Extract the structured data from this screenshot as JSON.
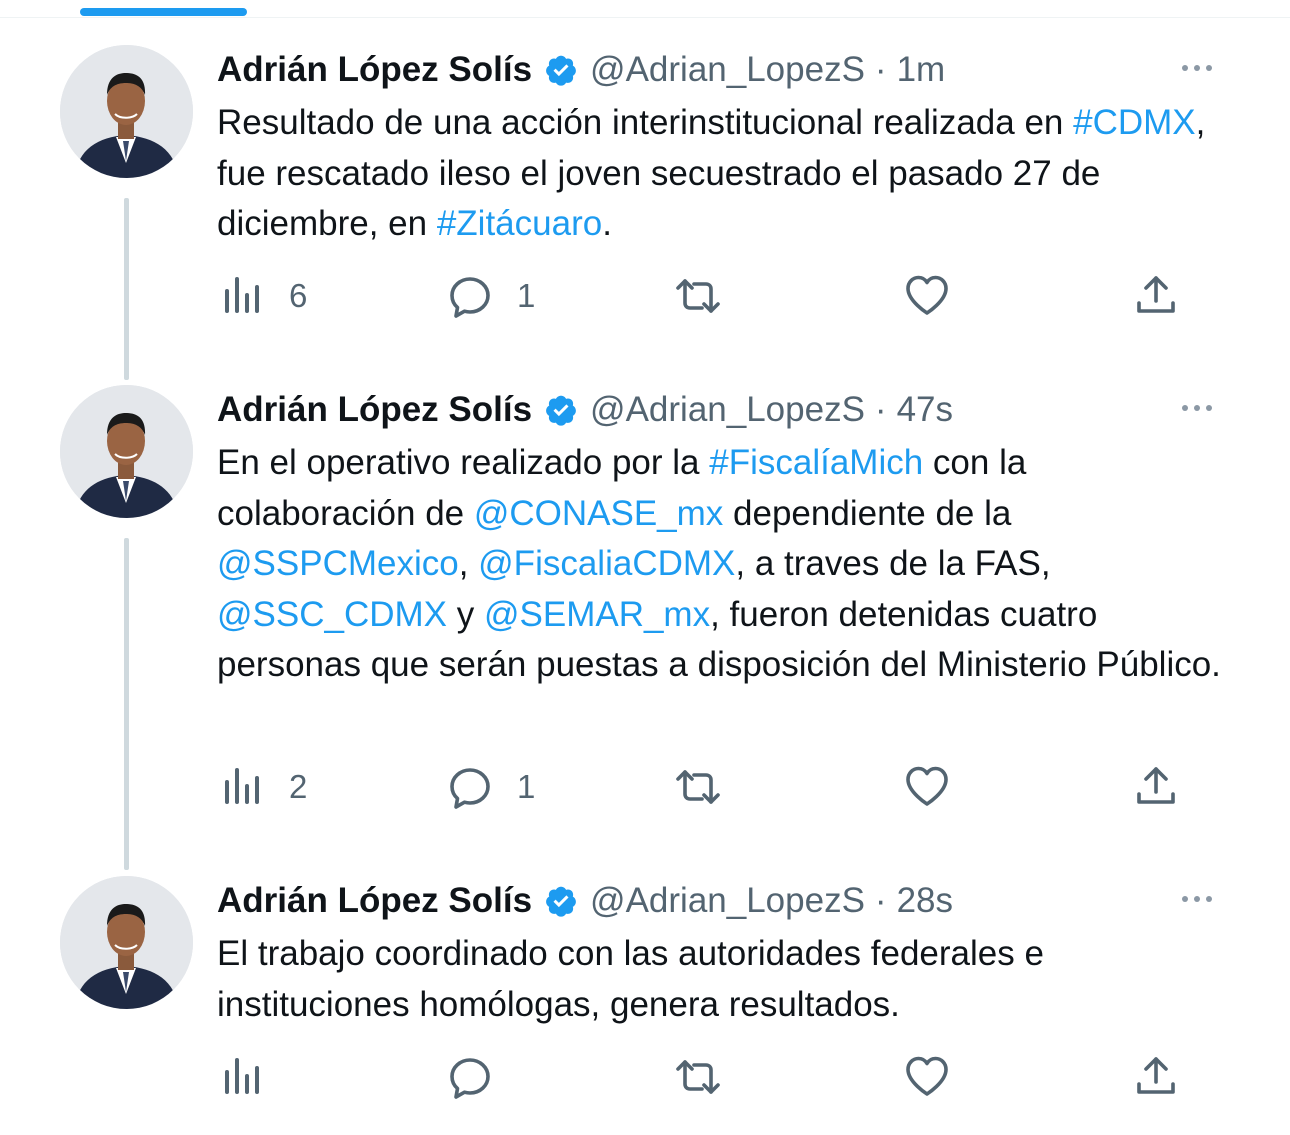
{
  "tabs": {
    "active_indicator_color": "#1d9bf0"
  },
  "tweets": [
    {
      "author": {
        "name": "Adrián López Solís",
        "handle": "@Adrian_LopezS",
        "verified": true
      },
      "time": "1m",
      "text": [
        {
          "t": "Resultado de una acción interinstitucional realizada en "
        },
        {
          "t": "#CDMX",
          "link": true
        },
        {
          "t": ", fue rescatado ileso el joven secuestrado el pasado 27 de diciembre, en "
        },
        {
          "t": "#Zitácuaro",
          "link": true
        },
        {
          "t": "."
        }
      ],
      "stats": {
        "views": "6",
        "replies": "1",
        "retweets": "",
        "likes": ""
      }
    },
    {
      "author": {
        "name": "Adrián López Solís",
        "handle": "@Adrian_LopezS",
        "verified": true
      },
      "time": "47s",
      "text": [
        {
          "t": "En el operativo realizado por la "
        },
        {
          "t": "#FiscalíaMich",
          "link": true
        },
        {
          "t": " con la colaboración de "
        },
        {
          "t": "@CONASE_mx",
          "link": true
        },
        {
          "t": " dependiente de la "
        },
        {
          "t": "@SSPCMexico",
          "link": true
        },
        {
          "t": ", "
        },
        {
          "t": "@FiscaliaCDMX",
          "link": true
        },
        {
          "t": ", a traves de la FAS, "
        },
        {
          "t": "@SSC_CDMX",
          "link": true
        },
        {
          "t": " y "
        },
        {
          "t": "@SEMAR_mx",
          "link": true
        },
        {
          "t": ", fueron detenidas cuatro personas que serán puestas a disposición del Ministerio Público."
        }
      ],
      "stats": {
        "views": "2",
        "replies": "1",
        "retweets": "",
        "likes": ""
      }
    },
    {
      "author": {
        "name": "Adrián López Solís",
        "handle": "@Adrian_LopezS",
        "verified": true
      },
      "time": "28s",
      "text": [
        {
          "t": "El trabajo coordinado con las autoridades federales e instituciones homólogas, genera resultados."
        }
      ],
      "stats": {
        "views": "",
        "replies": "",
        "retweets": "",
        "likes": ""
      }
    }
  ],
  "icons": {
    "views": "analytics-icon",
    "reply": "reply-icon",
    "retweet": "retweet-icon",
    "like": "heart-icon",
    "share": "share-icon",
    "more": "more-options-icon",
    "verified": "verified-badge-icon"
  },
  "colors": {
    "link": "#1d9bf0",
    "secondary_text": "#536471",
    "thread_line": "#cfd9de"
  }
}
